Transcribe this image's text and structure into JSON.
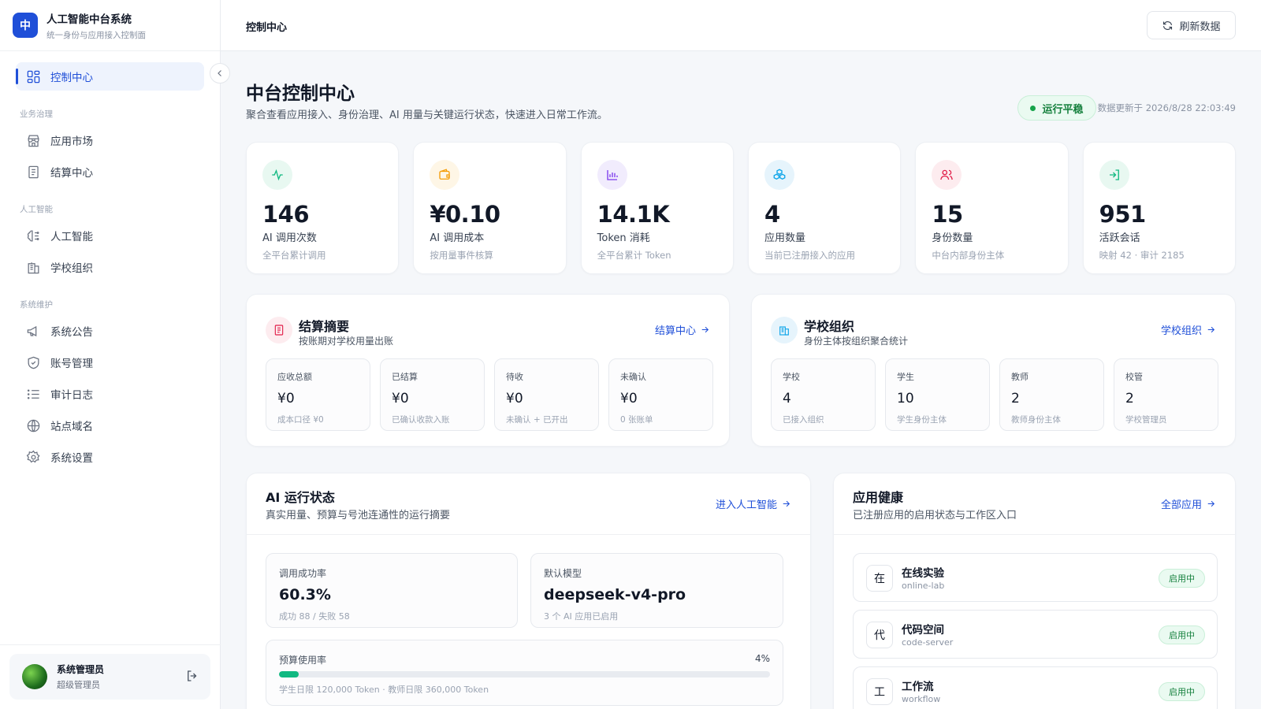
{
  "brand": {
    "logo_char": "中",
    "title": "人工智能中台系统",
    "subtitle": "统一身份与应用接入控制面"
  },
  "sidebar": {
    "active": {
      "label": "控制中心",
      "icon": "dashboard-icon"
    },
    "groups": [
      {
        "label": "业务治理",
        "items": [
          {
            "label": "应用市场",
            "icon": "store-icon"
          },
          {
            "label": "结算中心",
            "icon": "receipt-icon"
          }
        ]
      },
      {
        "label": "人工智能",
        "items": [
          {
            "label": "人工智能",
            "icon": "brain-icon"
          },
          {
            "label": "学校组织",
            "icon": "building-icon"
          }
        ]
      },
      {
        "label": "系统维护",
        "items": [
          {
            "label": "系统公告",
            "icon": "megaphone-icon"
          },
          {
            "label": "账号管理",
            "icon": "shield-icon"
          },
          {
            "label": "审计日志",
            "icon": "list-icon"
          },
          {
            "label": "站点域名",
            "icon": "globe-icon"
          },
          {
            "label": "系统设置",
            "icon": "gear-icon"
          }
        ]
      }
    ]
  },
  "user": {
    "name": "系统管理员",
    "role": "超级管理员"
  },
  "topbar": {
    "breadcrumb": "控制中心",
    "refresh_label": "刷新数据"
  },
  "page": {
    "title": "中台控制中心",
    "description": "聚合查看应用接入、身份治理、AI 用量与关键运行状态，快速进入日常工作流。",
    "status": "运行平稳",
    "updated": "数据更新于 2026/8/28 22:03:49"
  },
  "stats": [
    {
      "value": "146",
      "label": "AI 调用次数",
      "sub": "全平台累计调用",
      "icon": "activity-icon",
      "color": "#10b981",
      "bg": "#e8f8f1"
    },
    {
      "value": "¥0.10",
      "label": "AI 调用成本",
      "sub": "按用量事件核算",
      "icon": "wallet-icon",
      "color": "#f59e0b",
      "bg": "#fef6e6"
    },
    {
      "value": "14.1K",
      "label": "Token 消耗",
      "sub": "全平台累计 Token",
      "icon": "bar-chart-icon",
      "color": "#7c3aed",
      "bg": "#f1ecfd"
    },
    {
      "value": "4",
      "label": "应用数量",
      "sub": "当前已注册接入的应用",
      "icon": "boxes-icon",
      "color": "#0ea5e9",
      "bg": "#e6f4fc"
    },
    {
      "value": "15",
      "label": "身份数量",
      "sub": "中台内部身份主体",
      "icon": "users-icon",
      "color": "#e11d48",
      "bg": "#fdecef"
    },
    {
      "value": "951",
      "label": "活跃会话",
      "sub": "映射 42 · 审计 2185",
      "icon": "login-icon",
      "color": "#10b981",
      "bg": "#e8f8f1"
    }
  ],
  "settlement": {
    "title": "结算摘要",
    "subtitle": "按账期对学校用量出账",
    "link": "结算中心",
    "items": [
      {
        "label": "应收总额",
        "value": "¥0",
        "sub": "成本口径 ¥0"
      },
      {
        "label": "已结算",
        "value": "¥0",
        "sub": "已确认收款入账"
      },
      {
        "label": "待收",
        "value": "¥0",
        "sub": "未确认 + 已开出"
      },
      {
        "label": "未确认",
        "value": "¥0",
        "sub": "0 张账单"
      }
    ]
  },
  "school": {
    "title": "学校组织",
    "subtitle": "身份主体按组织聚合统计",
    "link": "学校组织",
    "items": [
      {
        "label": "学校",
        "value": "4",
        "sub": "已接入组织"
      },
      {
        "label": "学生",
        "value": "10",
        "sub": "学生身份主体"
      },
      {
        "label": "教师",
        "value": "2",
        "sub": "教师身份主体"
      },
      {
        "label": "校管",
        "value": "2",
        "sub": "学校管理员"
      }
    ]
  },
  "ai_status": {
    "title": "AI 运行状态",
    "subtitle": "真实用量、预算与号池连通性的运行摘要",
    "link": "进入人工智能",
    "success": {
      "label": "调用成功率",
      "value": "60.3%",
      "sub": "成功 88 / 失败 58"
    },
    "model": {
      "label": "默认模型",
      "value": "deepseek-v4-pro",
      "sub": "3 个 AI 应用已启用"
    },
    "budget": {
      "label": "预算使用率",
      "percent_label": "4%",
      "percent": 4,
      "sub": "学生日限 120,000 Token · 教师日限 360,000 Token"
    }
  },
  "app_health": {
    "title": "应用健康",
    "subtitle": "已注册应用的启用状态与工作区入口",
    "link": "全部应用",
    "apps": [
      {
        "char": "在",
        "name": "在线实验",
        "id": "online-lab",
        "status": "启用中"
      },
      {
        "char": "代",
        "name": "代码空间",
        "id": "code-server",
        "status": "启用中"
      },
      {
        "char": "工",
        "name": "工作流",
        "id": "workflow",
        "status": "启用中"
      }
    ]
  },
  "colors": {
    "accent": "#1f4fd8",
    "success": "#16a34a"
  }
}
